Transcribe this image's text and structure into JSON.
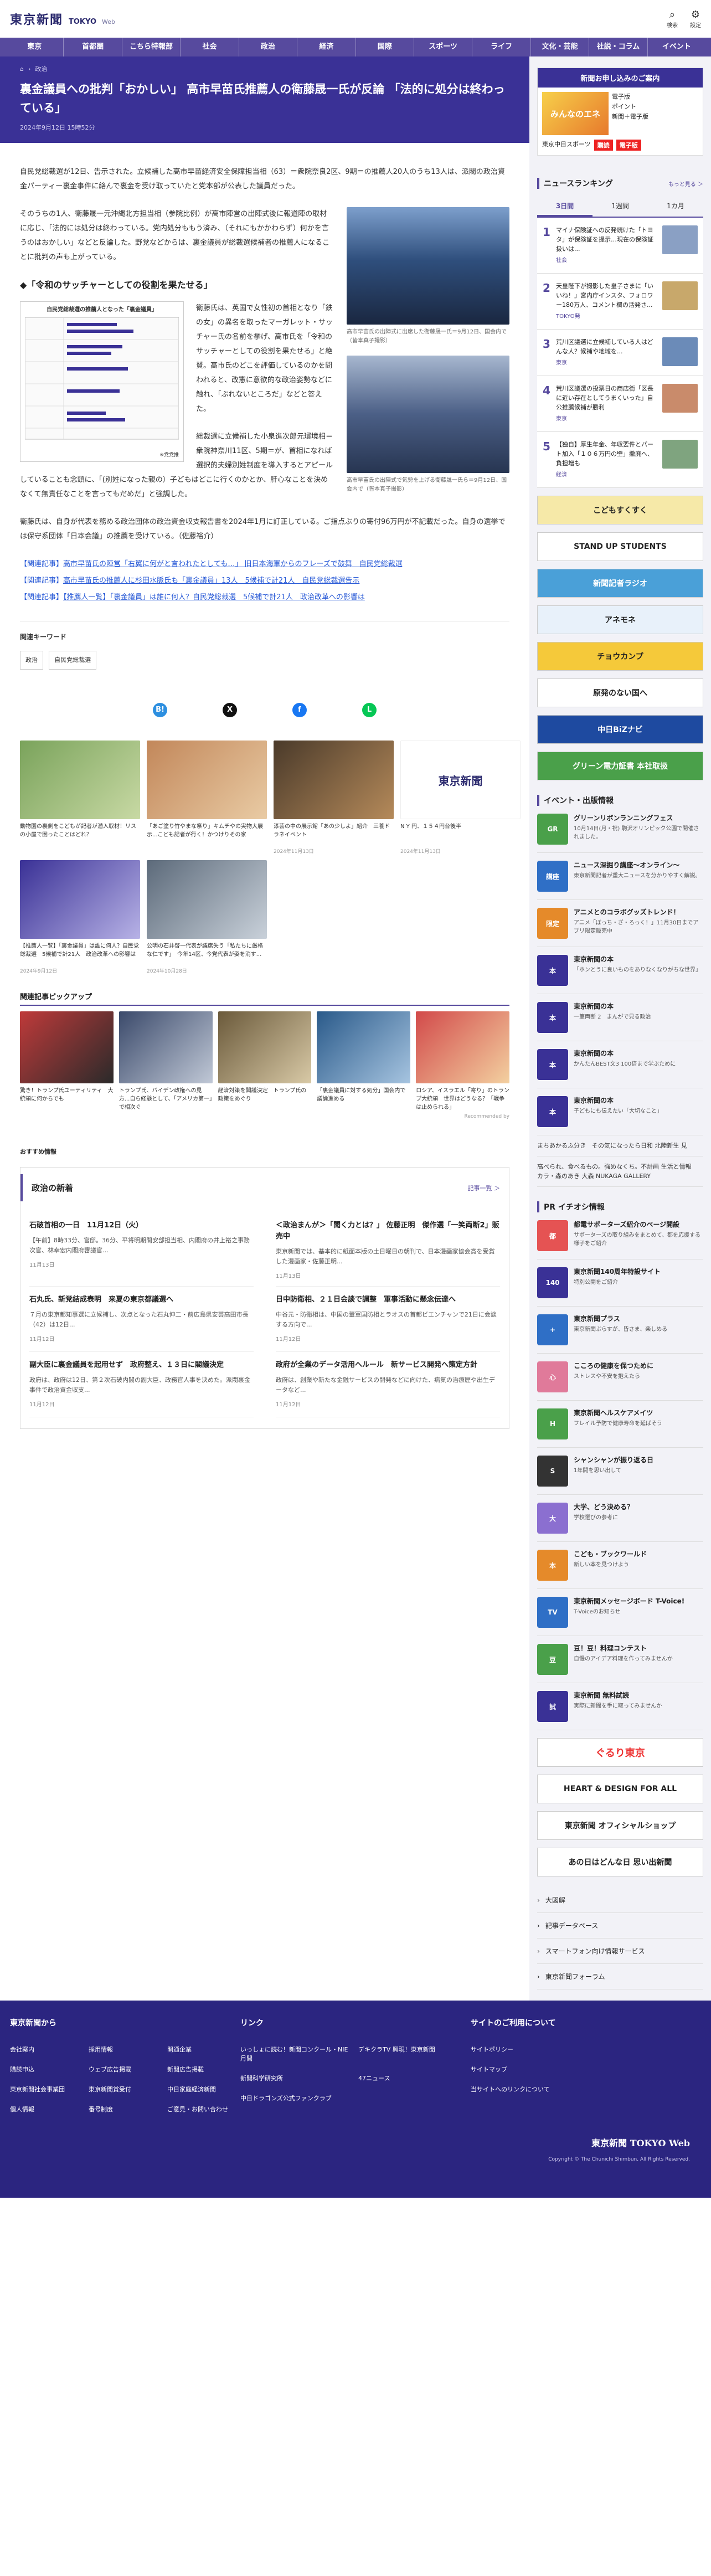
{
  "header": {
    "logo_jp": "東京新聞",
    "logo_en": "TOKYO",
    "logo_web": "Web",
    "search_label": "検索",
    "menu_label": "設定"
  },
  "nav": [
    "東京",
    "首都圏",
    "こちら特報部",
    "社会",
    "政治",
    "経済",
    "国際",
    "スポーツ",
    "ライフ",
    "文化・芸能",
    "社説・コラム",
    "イベント"
  ],
  "breadcrumb": {
    "home": "⌂",
    "section": "政治"
  },
  "article": {
    "title": "裏金議員への批判「おかしい」 高市早苗氏推薦人の衛藤晟一氏が反論 「法的に処分は終わっている」",
    "date": "2024年9月12日 15時52分",
    "p1": "自民党総裁選が12日、告示された。立候補した高市早苗経済安全保障担当相（63）＝衆院奈良2区、9期＝の推薦人20人のうち13人は、派閥の政治資金パーティー裏金事件に絡んで裏金を受け取っていたと党本部が公表した議員だった。",
    "p2": "そのうちの1人、衛藤晟一元沖縄北方担当相（参院比例）が高市陣営の出陣式後に報道陣の取材に応じ、「法的には処分は終わっている。党内処分ももう済み、（それにもかかわらず）何かを言うのはおかしい」などと反論した。野党などからは、裏金議員が総裁選候補者の推薦人になることに批判の声も上がっている。",
    "h2": "◆「令和のサッチャーとしての役割を果たせる」",
    "p3": "衛藤氏は、英国で女性初の首相となり「鉄の女」の異名を取ったマーガレット・サッチャー氏の名前を挙げ、高市氏を「令和のサッチャーとしての役割を果たせる」と絶賛。高市氏のどこを評価しているのかを問われると、改憲に意欲的な政治姿勢などに触れ、「ぶれないところだ」などと答えた。",
    "p4": "総裁選に立候補した小泉進次郎元環境相＝衆院神奈川11区、5期＝が、首相になれば選択的夫婦別姓制度を導入するとアピールしていることも念頭に、「(別姓になった親の）子どもはどこに行くのかとか、肝心なことを決めなくて無責任なことを言ってもだめだ」と強調した。",
    "p5": "衛藤氏は、自身が代表を務める政治団体の政治資金収支報告書を2024年1月に訂正している。ご指点ぶりの寄付96万円が不記載だった。自身の選挙では保守系団体「日本会議」の推薦を受けている。（佐藤裕介）",
    "fig1_caption": "高市早苗氏の出陣式に出席した衛藤晟一氏＝9月12日、国会内で（皆本真子撮影）",
    "fig2_caption": "高市早苗氏の出陣式で気勢を上げる衛藤晟一氏ら＝9月12日、国会内で（皆本真子撮影）",
    "inline_title": "自民党総裁選の推薦人となった「裏金議員」",
    "inline_note": "※党党推",
    "related": [
      {
        "label": "【関連記事】",
        "text": "高市早苗氏の陣営「右翼に何がと言われたとしても…」 旧日本海軍からのフレーズで鼓舞　自民党総裁選"
      },
      {
        "label": "【関連記事】",
        "text": "高市早苗氏の推薦人に杉田水脈氏も「裏金議員」13人　5候補で計21人　自民党総裁選告示"
      },
      {
        "label": "【関連記事】",
        "text": "【推薦人一覧】「裏金議員」は誰に何人？自民党総裁選　5候補で計21人　政治改革への影響は"
      }
    ]
  },
  "keywords": {
    "title": "関連キーワード",
    "items": [
      "政治",
      "自民党総裁選"
    ]
  },
  "share": [
    {
      "name": "hatena",
      "g": "B!"
    },
    {
      "name": "x",
      "g": "X"
    },
    {
      "name": "facebook",
      "g": "f"
    },
    {
      "name": "line",
      "g": "L"
    }
  ],
  "cards": [
    {
      "text": "動物園の裏側をこどもが記者が潜入取材！リスの小屋で困ったことはどれ？",
      "date": ""
    },
    {
      "text": "「あご塗り竹やまな祭り」キムチやの実物大展示...こども記者が行く！かつけりその家",
      "date": ""
    },
    {
      "text": "漆芸の中の展示館「あの少しよ」紹介　三養ドラネイベント",
      "date": "2024年11月13日"
    },
    {
      "text": "N Y 円、１５４円台後半",
      "date": "2024年11月13日"
    },
    {
      "text": "【推薦人一覧】「裏金議員」は誰に何人？自民党総裁選　5候補で計21人　政治改革への影響は",
      "date": "2024年9月12日"
    },
    {
      "text": "公明の石井啓一代表が議席失う「私たちに厳格な仁です」　今年14区、今党代表が姿を消す...",
      "date": "2024年10月28日"
    }
  ],
  "pickup": {
    "title": "関連記事ピックアップ",
    "items": [
      "驚き！トランプ氏ユーティリティ　大統領に何からでも",
      "トランプ氏、バイデン政権への見方...自ら経験として、「アメリカ第一」で相次ぐ",
      "経済対策を閣議決定　トランプ氏の政策をめぐり",
      "「裏金議員に対する処分」国会内で議論進める",
      "ロシア、イスラエル「寄り」のトランプ大統領　世界はどうなる？「戦争は止められる」"
    ],
    "credit": "Recommended by"
  },
  "osusume": "おすすめ情報",
  "politics_news": {
    "title": "政治の新着",
    "more": "記事一覧 ＞",
    "items": [
      {
        "t": "石破首相の一日　11月12日（火）",
        "b": "【午前】8時33分、官邸。36分、平将明期間安部担当相、内閣府の井上裕之事務次官、林幸宏内閣府審議官…",
        "d": "11月13日"
      },
      {
        "t": "＜政治まんが＞「聞く力とは？」 佐藤正明　傑作選「一笑両断2」販売中",
        "b": "東京新聞では、基本的に紙面本版の土日曜日の朝刊で、日本漫画家協会賞を受賞した漫画家・佐藤正明...",
        "d": "11月13日"
      },
      {
        "t": "石丸氏、新党結成表明　来夏の東京都議選へ",
        "b": "７月の東京都知事選に立候補し、次点となった石丸伸二・前広島県安芸高田市長（42）は12日...",
        "d": "11月12日"
      },
      {
        "t": "日中防衛相、２１日会談で調整　軍事活動に懸念伝達へ",
        "b": "中谷元・防衛相は、中国の董軍国防相とラオスの首都ビエンチャンで21日に会談する方向で...",
        "d": "11月12日"
      },
      {
        "t": "副大臣に裏金議員を起用せず　政府整え、１３日に閣議決定",
        "b": "政府は、政府は12日、第２次石破内閣の副大臣、政務官人事を決めた。派閥裏金事件で政治資金収支...",
        "d": "11月12日"
      },
      {
        "t": "政府が全業のデータ活用ヘルール　新サービス開発へ策定方針",
        "b": "政府は、創業や新たな金融サービスの開発などに向けた、病気の治療歴や出生データなど...",
        "d": "11月12日"
      }
    ]
  },
  "side": {
    "ad_top": "新聞お申し込みのご案内",
    "ad_paper": "みんなのエネ",
    "ad_list": [
      "電子版",
      "ポイント",
      "新聞＋電子版"
    ],
    "ad_foot1": "東京中日スポーツ",
    "ad_foot2": "購読",
    "ad_foot3": "電子版",
    "ranking_title": "ニュースランキング",
    "ranking_more": "もっと見る ＞",
    "ranking_tabs": [
      "3日間",
      "1週間",
      "1カ月"
    ],
    "ranking": [
      {
        "n": "1",
        "t": "マイナ保険証への反発続けた「トヨタ」が保険証を提示…現在の保険証扱いは...",
        "c": "社会"
      },
      {
        "n": "2",
        "t": "天皇陛下が撮影した皇子さまに「いいね！」宮内庁インスタ、フォロワー180万人、コメント欄の活発さ...",
        "c": "TOKYO発"
      },
      {
        "n": "3",
        "t": "荒川区議選に立候補している人はどんな人？候補や地域を...",
        "c": "東京"
      },
      {
        "n": "4",
        "t": "荒川区議選の投票日の商店街「区長に近い存在としてうまくいった」自公推薦候補が勝利",
        "c": "東京"
      },
      {
        "n": "5",
        "t": "【独自】厚生年金、年収要件とパート加入「１０６万円の壁」撤廃へ、負担増も",
        "c": "経済"
      }
    ],
    "banners": [
      "こどもすくすく",
      "STAND UP STUDENTS",
      "新聞記者ラジオ",
      "アネモネ",
      "チョウカンプ",
      "原発のない国へ",
      "中日BiZナビ",
      "グリーン電力証書 本社取扱"
    ],
    "events_title": "イベント・出版情報",
    "events": [
      {
        "t": "グリーンリボンランニングフェス",
        "b": "10月14日(月・祝) 駒沢オリンピック公園で開催されました。",
        "color": "#4aa04a",
        "ic": "GR"
      },
      {
        "t": "ニュース深掘り講座〜オンライン〜",
        "b": "東京新聞記者が重大ニュースを分かりやすく解説。",
        "color": "#2f6fc6",
        "ic": "講座"
      },
      {
        "t": "アニメとのコラボグッズトレンド！",
        "b": "アニメ「ぼっち・ざ・ろっく！」11月30日までアプリ限定販売中",
        "color": "#e58a2a",
        "ic": "限定"
      },
      {
        "t": "東京新聞の本",
        "b": "「ホンとうに良いものをありなくなりがちな世界」",
        "color": "#3a3196",
        "ic": "本"
      },
      {
        "t": "東京新聞の本",
        "b": "一筆両断 2　まんがで見る政治",
        "color": "#3a3196",
        "ic": "本"
      },
      {
        "t": "東京新聞の本",
        "b": "かんたんBEST文3 100倍まで学ぶために",
        "color": "#3a3196",
        "ic": "本"
      },
      {
        "t": "東京新聞の本",
        "b": "子どもにも伝えたい「大切なこと」",
        "color": "#3a3196",
        "ic": "本"
      }
    ],
    "pr_links": [
      "まちあかるふ分き　その気になったら日和 北陸新生 見",
      "高べられ、食べるもの。強めなくち。不計画 生活と情報　カラ・森のあき 大森 NUKAGA GALLERY"
    ],
    "pr_title": "PR イチオシ情報",
    "pr": [
      {
        "t": "都電サポーターズ紹介のページ開設",
        "b": "サポーターズの取り組みをまとめて、都を応援する様子をご紹介",
        "color": "#e55353",
        "ic": "都"
      },
      {
        "t": "東京新聞140周年特設サイト",
        "b": "特別公開をご紹介",
        "color": "#3a3196",
        "ic": "140"
      },
      {
        "t": "東京新聞プラス",
        "b": "東京新聞ぷらすが、皆さま、楽しめる",
        "color": "#2f6fc6",
        "ic": "+"
      },
      {
        "t": "こころの健康を保つために",
        "b": "ストレスや不安を抱えたら",
        "color": "#e07a9a",
        "ic": "心"
      },
      {
        "t": "東京新聞ヘルスケアメイツ",
        "b": "フレイル予防で健康寿命を延ばそう",
        "color": "#4aa04a",
        "ic": "H"
      },
      {
        "t": "シャンシャンが振り返る日",
        "b": "1年間を思い出して",
        "color": "#333",
        "ic": "S"
      },
      {
        "t": "大学、どう決める？",
        "b": "学校選びの参考に",
        "color": "#8b6fd0",
        "ic": "大"
      },
      {
        "t": "こども・ブックワールド",
        "b": "新しい本を見つけよう",
        "color": "#e58a2a",
        "ic": "本"
      },
      {
        "t": "東京新聞メッセージボード T-Voice!",
        "b": "T-Voiceのお知らせ",
        "color": "#2f6fc6",
        "ic": "TV"
      },
      {
        "t": "豆！豆！料理コンテスト",
        "b": "自慢のアイデア料理を作ってみませんか",
        "color": "#4aa04a",
        "ic": "豆"
      },
      {
        "t": "東京新聞 無料試読",
        "b": "実際に新聞を手に取ってみませんか",
        "color": "#3a3196",
        "ic": "試"
      }
    ],
    "bottom_banners": [
      "ぐるり東京",
      "HEART & DESIGN FOR ALL",
      "東京新聞 オフィシャルショップ",
      "あの日はどんな日 思い出新聞"
    ],
    "links": [
      "大図解",
      "記事データベース",
      "スマートフォン向け情報サービス",
      "東京新聞フォーラム"
    ]
  },
  "footer": {
    "cols": [
      {
        "h": "東京新聞から",
        "items": [
          "会社案内",
          "採用情報",
          "開通企業",
          "購読申込",
          "ウェブ広告掲載",
          "新聞広告掲載",
          "東京新聞社会事業団",
          "東京新聞賞受付",
          "中日家庭経済新聞",
          "個人情報",
          "番号制度",
          "ご意見・お問い合わせ"
        ]
      },
      {
        "h": "リンク",
        "items": [
          "いっしょに読む！新聞コンクール・NIE月間",
          "デキクラTV 興現！東京新聞",
          "新聞科学研究所",
          "47ニュース",
          "中日ドラゴンズ公式ファンクラブ"
        ]
      },
      {
        "h": "サイトのご利用について",
        "items": [
          "サイトポリシー",
          "サイトマップ",
          "当サイトへのリンクについて"
        ]
      }
    ],
    "logo": "東京新聞 TOKYO Web",
    "copyright": "Copyright © The Chunichi Shimbun, All Rights Reserved."
  }
}
